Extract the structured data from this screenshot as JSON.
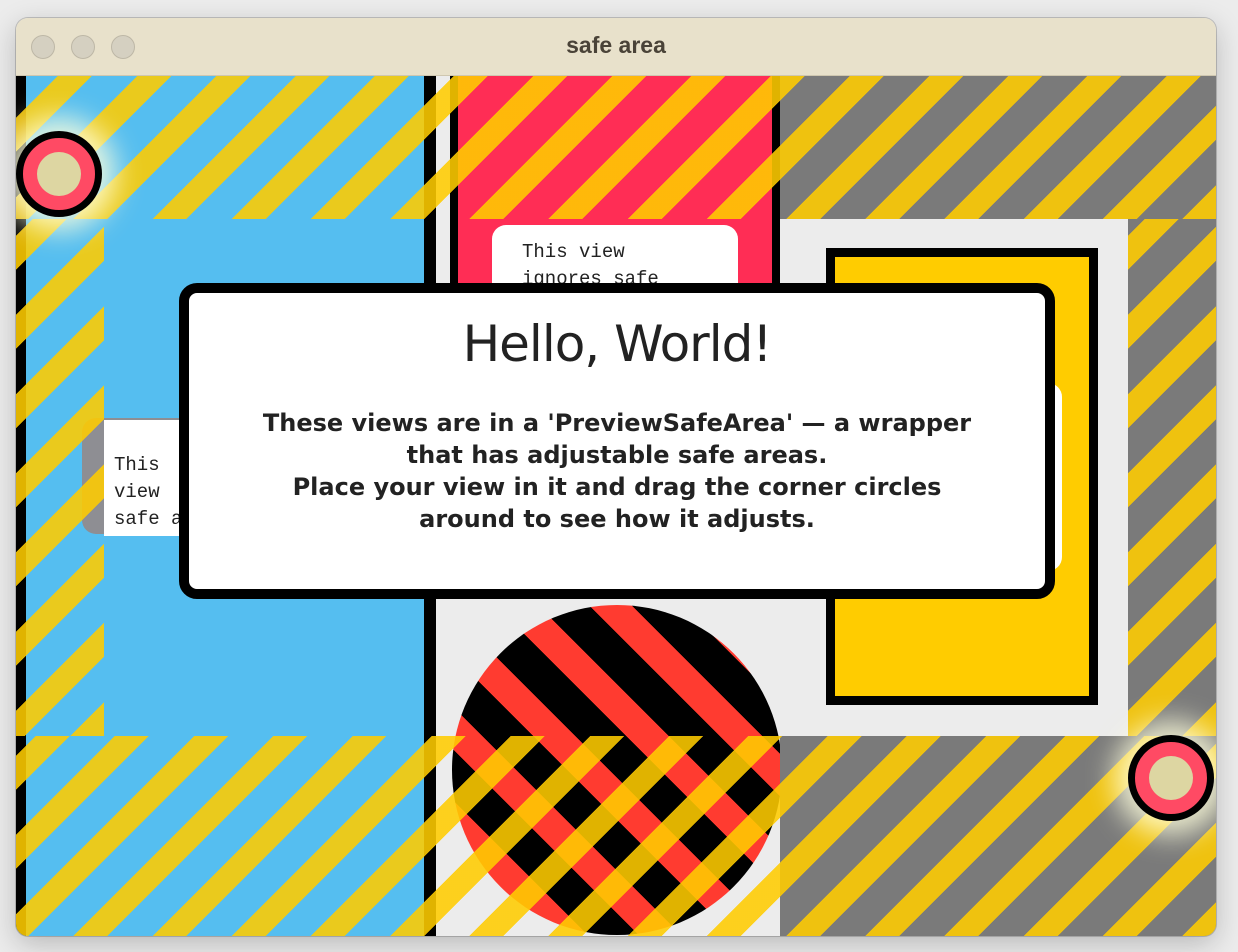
{
  "window": {
    "title": "safe area"
  },
  "notes": {
    "top": "This view ignores safe",
    "left": "This view safe a"
  },
  "dialog": {
    "heading": "Hello, World!",
    "line1": "These views are in a 'PreviewSafeArea' — a wrapper that has adjustable safe areas.",
    "line2": "Place your view in it and drag the corner circles around to see how it adjusts."
  },
  "colors": {
    "hazard_yellow": "#ffcc00",
    "blue": "#55bef0",
    "red": "#ff2d55",
    "handle": "#ff4a64"
  }
}
